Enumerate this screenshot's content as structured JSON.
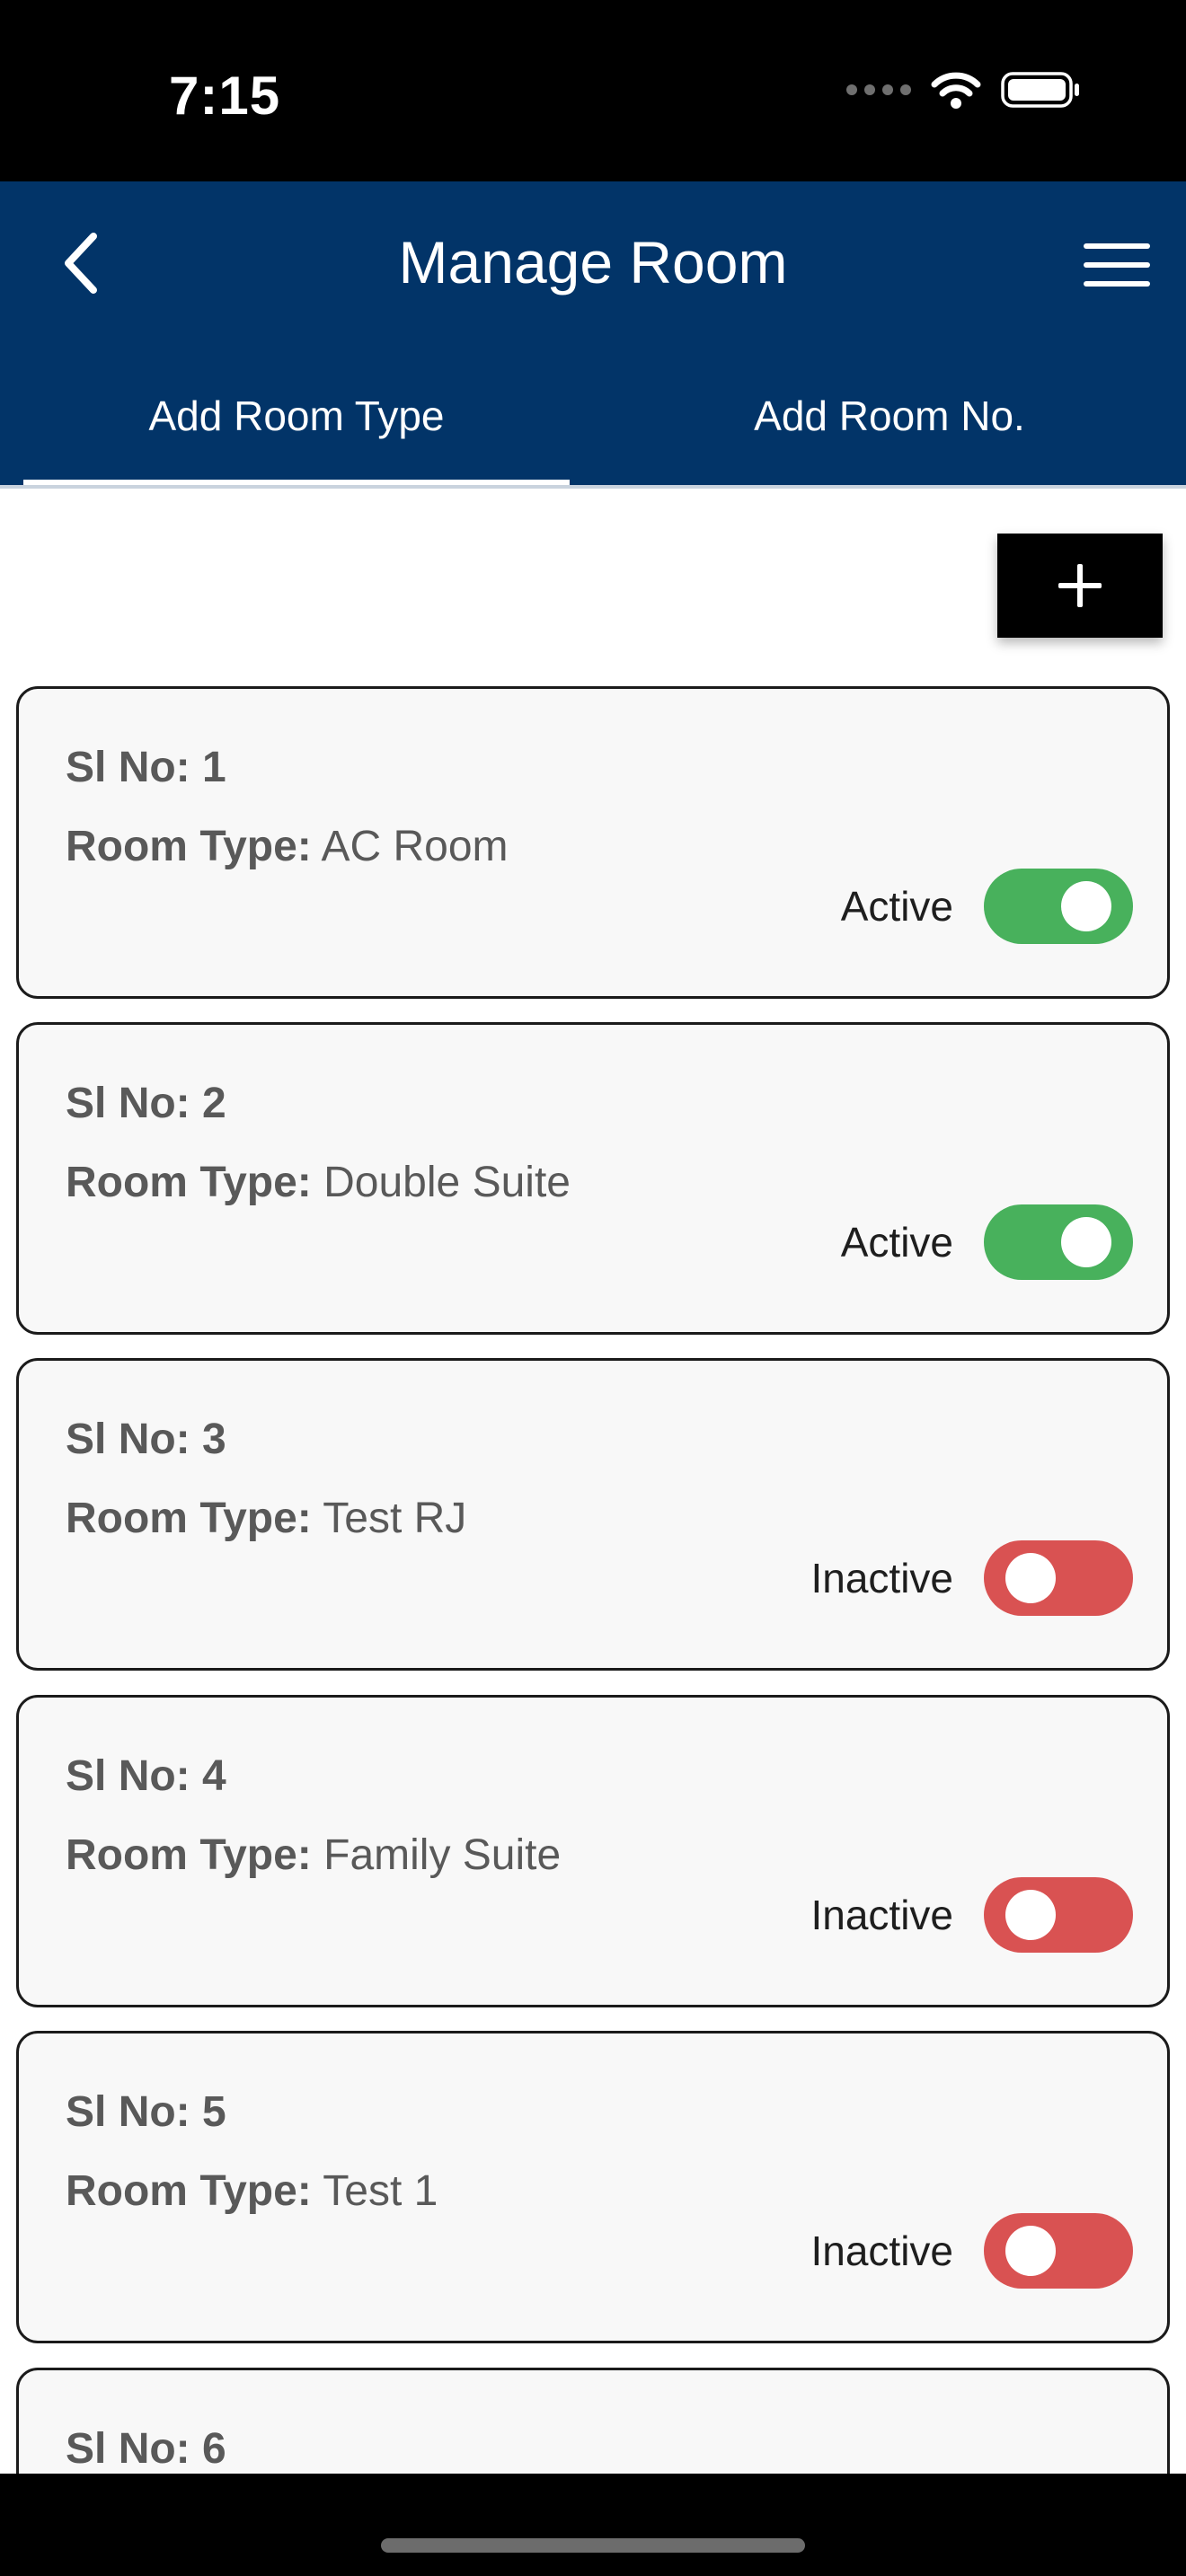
{
  "status_bar": {
    "time": "7:15",
    "icons": [
      "signal-dots-icon",
      "wifi-icon",
      "battery-icon"
    ]
  },
  "header": {
    "title": "Manage Room",
    "back_icon": "chevron-left-icon",
    "menu_icon": "hamburger-menu-icon",
    "background": "#023468"
  },
  "tabs": [
    {
      "label": "Add Room Type",
      "selected": true
    },
    {
      "label": "Add Room No.",
      "selected": false
    }
  ],
  "add_button": {
    "icon": "plus-icon"
  },
  "rooms": [
    {
      "sl_label": "Sl No: 1",
      "type_label": "Room Type:",
      "type_value": "AC Room",
      "status": "Active",
      "on": true
    },
    {
      "sl_label": "Sl No: 2",
      "type_label": "Room Type:",
      "type_value": "Double Suite",
      "status": "Active",
      "on": true
    },
    {
      "sl_label": "Sl No: 3",
      "type_label": "Room Type:",
      "type_value": "Test RJ",
      "status": "Inactive",
      "on": false
    },
    {
      "sl_label": "Sl No: 4",
      "type_label": "Room Type:",
      "type_value": "Family Suite",
      "status": "Inactive",
      "on": false
    },
    {
      "sl_label": "Sl No: 5",
      "type_label": "Room Type:",
      "type_value": "Test 1",
      "status": "Inactive",
      "on": false
    },
    {
      "sl_label": "Sl No: 6"
    }
  ],
  "colors": {
    "active_toggle": "#48b15c",
    "inactive_toggle": "#d95252"
  }
}
